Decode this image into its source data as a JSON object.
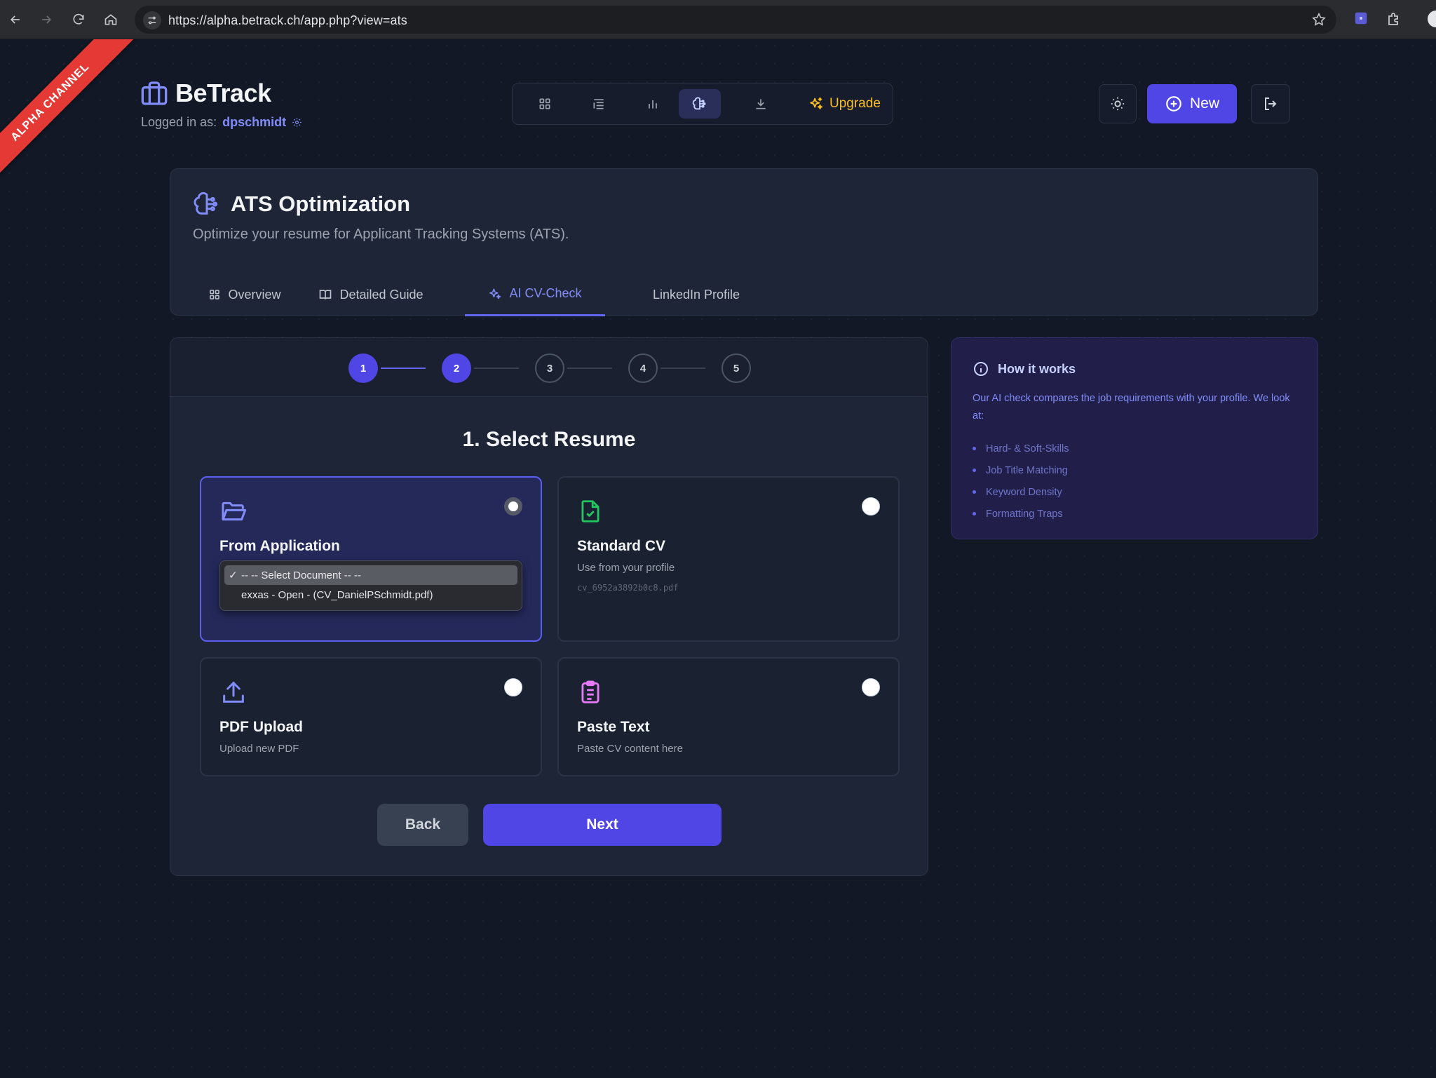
{
  "browser": {
    "url": "https://alpha.betrack.ch/app.php?view=ats"
  },
  "ribbon": "ALPHA CHANNEL",
  "header": {
    "brand": "BeTrack",
    "logged_in_label": "Logged in as:",
    "username": "dpschmidt",
    "upgrade_label": "Upgrade",
    "new_label": "New"
  },
  "page": {
    "title": "ATS Optimization",
    "subtitle": "Optimize your resume for Applicant Tracking Systems (ATS).",
    "tabs": [
      {
        "label": "Overview",
        "icon": "grid-icon"
      },
      {
        "label": "Detailed Guide",
        "icon": "book-icon"
      },
      {
        "label": "AI CV-Check",
        "icon": "sparkles-icon",
        "active": true
      },
      {
        "label": "LinkedIn Profile"
      }
    ]
  },
  "wizard": {
    "steps": [
      "1",
      "2",
      "3",
      "4",
      "5"
    ],
    "current_step": 2,
    "title": "1. Select Resume",
    "options": {
      "from_application": {
        "title": "From Application",
        "dropdown": [
          "-- -- Select Document -- --",
          "exxas - Open - (CV_DanielPSchmidt.pdf)"
        ]
      },
      "standard_cv": {
        "title": "Standard CV",
        "desc": "Use from your profile",
        "file": "cv_6952a3892b0c8.pdf"
      },
      "pdf_upload": {
        "title": "PDF Upload",
        "desc": "Upload new PDF"
      },
      "paste_text": {
        "title": "Paste Text",
        "desc": "Paste CV content here"
      }
    },
    "back_label": "Back",
    "next_label": "Next"
  },
  "info": {
    "title": "How it works",
    "text": "Our AI check compares the job requirements with your profile. We look at:",
    "items": [
      "Hard- & Soft-Skills",
      "Job Title Matching",
      "Keyword Density",
      "Formatting Traps"
    ]
  },
  "colors": {
    "accent": "#4f46e5",
    "upgrade": "#fbbf24",
    "ribbon": "#e53935",
    "success_icon": "#22c55e",
    "paste_icon": "#e879f9"
  }
}
